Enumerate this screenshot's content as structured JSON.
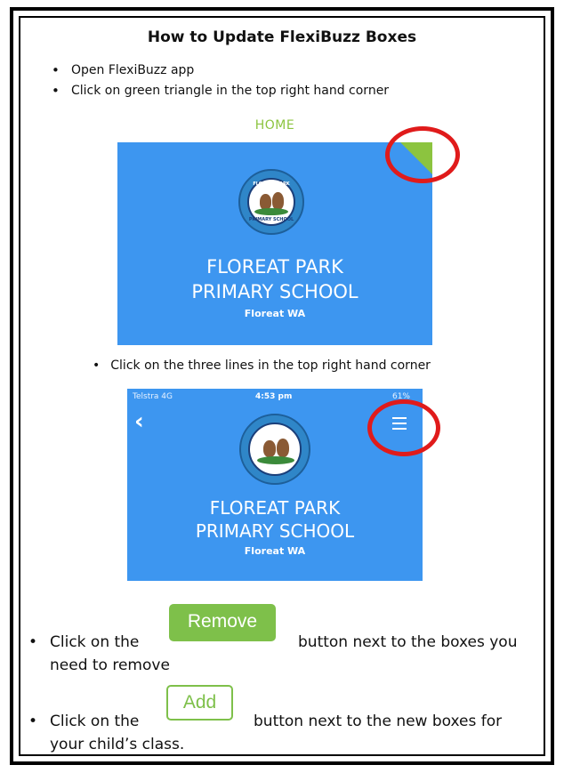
{
  "title": "How to Update FlexiBuzz Boxes",
  "steps": [
    "Open FlexiBuzz app",
    "Click on green triangle in the top right hand corner"
  ],
  "screenshot1": {
    "home_label": "HOME",
    "logo_text": "FLOREAT PARK",
    "logo_subtext": "PRIMARY SCHOOL",
    "school_line1": "FLOREAT PARK",
    "school_line2": "PRIMARY SCHOOL",
    "location": "Floreat WA",
    "accent_color": "#8cc43f",
    "background_color": "#3d96f0"
  },
  "step3": "Click on the three lines in the top right hand corner",
  "screenshot2": {
    "carrier": "Telstra  4G",
    "time": "4:53 pm",
    "battery": "61%",
    "back_icon": "chevron-left-icon",
    "menu_icon": "hamburger-menu-icon",
    "school_line1": "FLOREAT PARK",
    "school_line2": "PRIMARY SCHOOL",
    "location": "Floreat WA"
  },
  "remove_step": {
    "prefix": "Click on the",
    "button_label": "Remove",
    "suffix_line1": "button next to the boxes you",
    "suffix_line2": "need to remove",
    "button_color": "#7ec04a"
  },
  "add_step": {
    "prefix": "Click on the",
    "button_label": "Add",
    "suffix_line1": "button next to the new boxes for",
    "suffix_line2": "your child’s class.",
    "button_color": "#7ec04a"
  },
  "highlight_color": "#e01b1b"
}
